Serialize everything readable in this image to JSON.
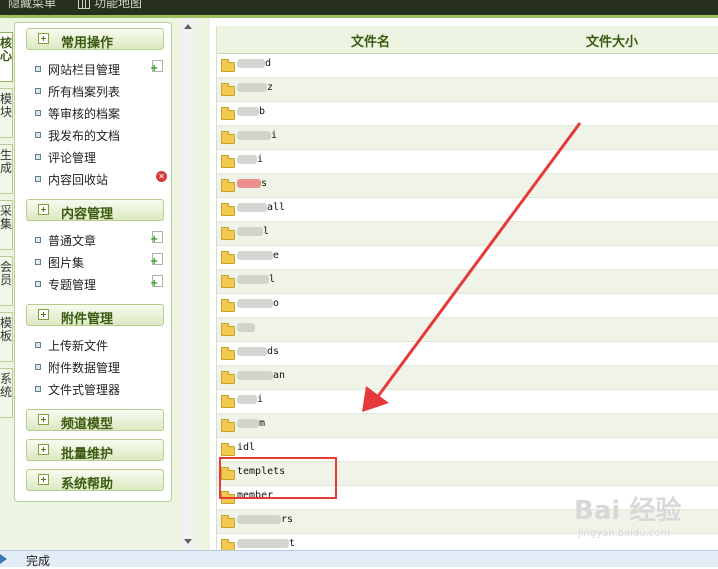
{
  "topbar": {
    "hidden_menu": "隐藏菜单",
    "function_map": "功能地图"
  },
  "side_tabs": [
    {
      "label": "核心",
      "active": true
    },
    {
      "label": "模块",
      "active": false
    },
    {
      "label": "生成",
      "active": false
    },
    {
      "label": "采集",
      "active": false
    },
    {
      "label": "会员",
      "active": false
    },
    {
      "label": "模板",
      "active": false
    },
    {
      "label": "系统",
      "active": false
    }
  ],
  "menu": {
    "common": {
      "title": "常用操作",
      "items": [
        "网站栏目管理",
        "所有档案列表",
        "等审核的档案",
        "我发布的文档",
        "评论管理",
        "内容回收站"
      ]
    },
    "content": {
      "title": "内容管理",
      "items": [
        "普通文章",
        "图片集",
        "专题管理"
      ]
    },
    "attachment": {
      "title": "附件管理",
      "items": [
        "上传新文件",
        "附件数据管理",
        "文件式管理器"
      ]
    },
    "channel": {
      "title": "频道模型"
    },
    "batch": {
      "title": "批量维护"
    },
    "help": {
      "title": "系统帮助"
    }
  },
  "table": {
    "col_name": "文件名",
    "col_size": "文件大小",
    "rows": [
      {
        "name": "d",
        "blur": 28
      },
      {
        "name": "z",
        "blur": 30
      },
      {
        "name": "b",
        "blur": 22
      },
      {
        "name": "i",
        "blur": 34
      },
      {
        "name": "i",
        "blur": 20
      },
      {
        "name": "s",
        "blur": 24,
        "red": true
      },
      {
        "name": "all",
        "blur": 30
      },
      {
        "name": "l",
        "blur": 26
      },
      {
        "name": "e",
        "blur": 36
      },
      {
        "name": "l",
        "blur": 32
      },
      {
        "name": "o",
        "blur": 36
      },
      {
        "name": "",
        "blur": 18
      },
      {
        "name": "ds",
        "blur": 30
      },
      {
        "name": "an",
        "blur": 36
      },
      {
        "name": "i",
        "blur": 20
      },
      {
        "name": "m",
        "blur": 22
      },
      {
        "name": "idl",
        "blur": 0
      },
      {
        "name": "templets",
        "blur": 0
      },
      {
        "name": "member",
        "blur": 0
      },
      {
        "name": "rs",
        "blur": 44
      },
      {
        "name": "t",
        "blur": 52
      }
    ]
  },
  "status": {
    "text": "完成"
  },
  "watermark": {
    "brand": "Bai 经验",
    "url": "jingyan.baidu.com"
  },
  "icons": {
    "add": "add-doc-icon",
    "trash": "trash-icon",
    "folder": "folder-icon",
    "map": "grid-icon"
  }
}
